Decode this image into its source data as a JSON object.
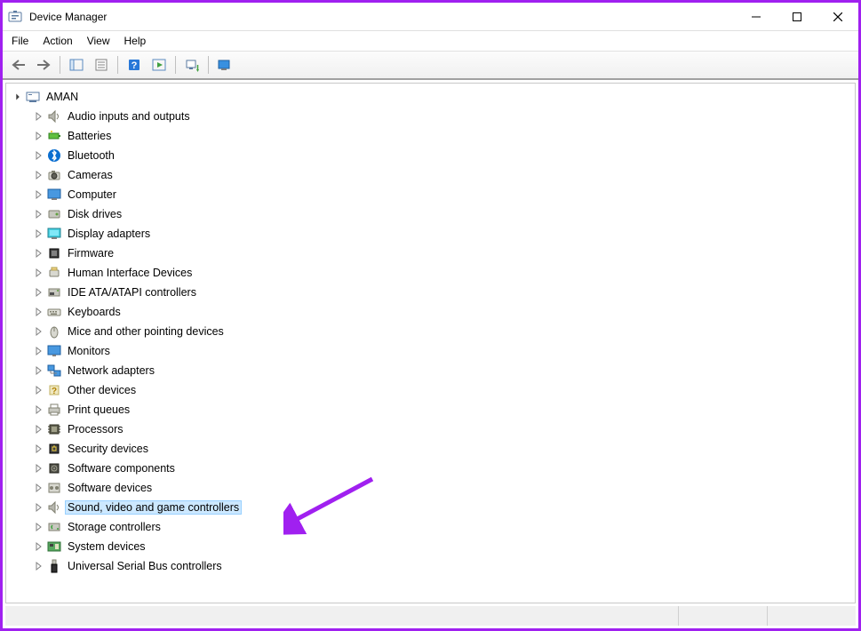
{
  "window": {
    "title": "Device Manager"
  },
  "menu": {
    "file": "File",
    "action": "Action",
    "view": "View",
    "help": "Help"
  },
  "tree": {
    "root": "AMAN",
    "items": [
      {
        "id": "audio",
        "label": "Audio inputs and outputs",
        "icon": "speaker"
      },
      {
        "id": "batteries",
        "label": "Batteries",
        "icon": "battery"
      },
      {
        "id": "bluetooth",
        "label": "Bluetooth",
        "icon": "bluetooth"
      },
      {
        "id": "cameras",
        "label": "Cameras",
        "icon": "camera"
      },
      {
        "id": "computer",
        "label": "Computer",
        "icon": "monitor"
      },
      {
        "id": "diskdrives",
        "label": "Disk drives",
        "icon": "disk"
      },
      {
        "id": "display",
        "label": "Display adapters",
        "icon": "display"
      },
      {
        "id": "firmware",
        "label": "Firmware",
        "icon": "chip"
      },
      {
        "id": "hid",
        "label": "Human Interface Devices",
        "icon": "hid"
      },
      {
        "id": "ide",
        "label": "IDE ATA/ATAPI controllers",
        "icon": "ide"
      },
      {
        "id": "keyboards",
        "label": "Keyboards",
        "icon": "keyboard"
      },
      {
        "id": "mice",
        "label": "Mice and other pointing devices",
        "icon": "mouse"
      },
      {
        "id": "monitors",
        "label": "Monitors",
        "icon": "monitor2"
      },
      {
        "id": "network",
        "label": "Network adapters",
        "icon": "network"
      },
      {
        "id": "other",
        "label": "Other devices",
        "icon": "other"
      },
      {
        "id": "print",
        "label": "Print queues",
        "icon": "printer"
      },
      {
        "id": "processors",
        "label": "Processors",
        "icon": "cpu"
      },
      {
        "id": "security",
        "label": "Security devices",
        "icon": "security"
      },
      {
        "id": "swcomp",
        "label": "Software components",
        "icon": "swcomp"
      },
      {
        "id": "swdev",
        "label": "Software devices",
        "icon": "swdev"
      },
      {
        "id": "sound",
        "label": "Sound, video and game controllers",
        "icon": "speaker",
        "selected": true
      },
      {
        "id": "storage",
        "label": "Storage controllers",
        "icon": "storage"
      },
      {
        "id": "system",
        "label": "System devices",
        "icon": "system"
      },
      {
        "id": "usb",
        "label": "Universal Serial Bus controllers",
        "icon": "usb"
      }
    ]
  },
  "colors": {
    "annotation": "#a020f0",
    "selection": "#cce8ff"
  }
}
